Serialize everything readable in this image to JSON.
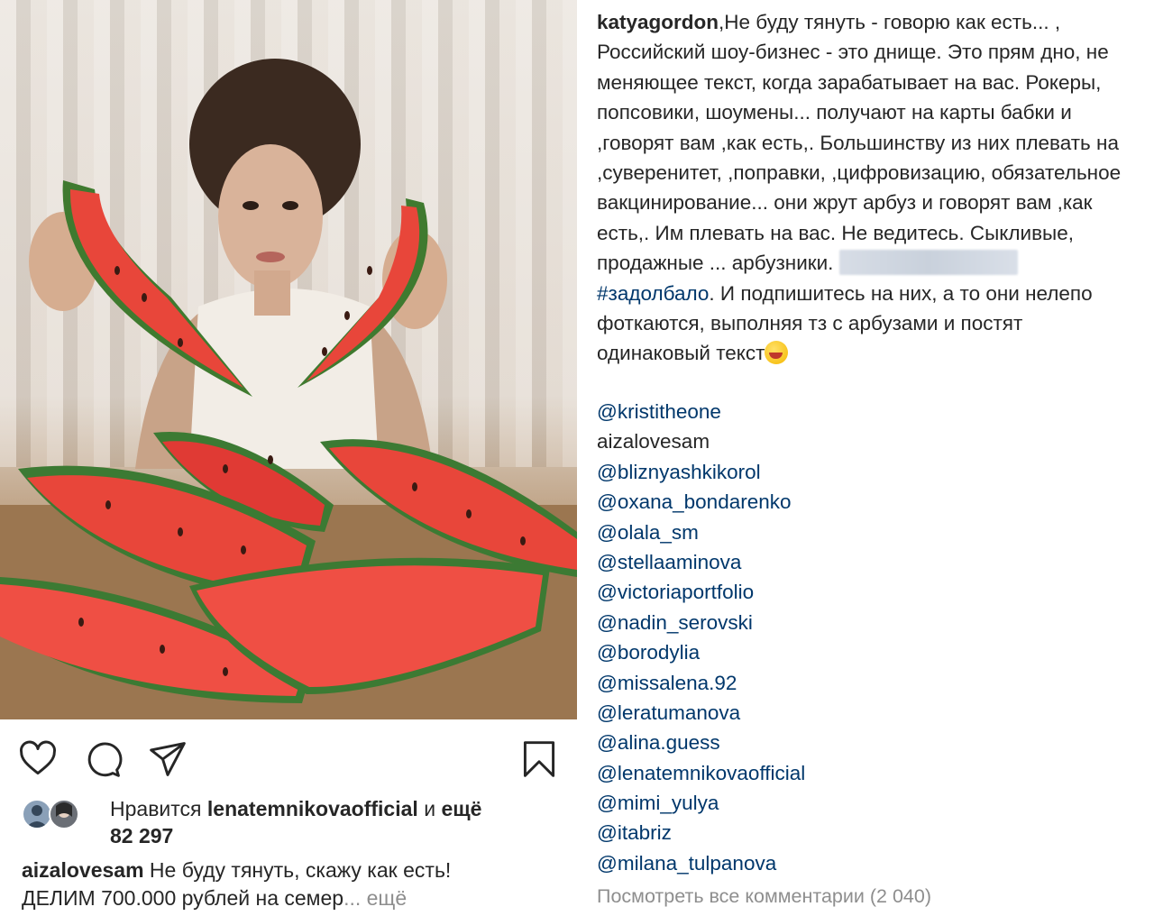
{
  "post": {
    "liked_by_prefix": "Нравится",
    "liked_by_user": "lenatemnikovaofficial",
    "liked_by_and": "и",
    "liked_by_more": "ещё",
    "likes_count": "82 297",
    "caption_user": "aizalovesam",
    "caption_line1": "Не буду тянуть, скажу как есть!",
    "caption_line2": "ДЕЛИМ 700.000 рублей на семер",
    "caption_ellipsis": "...",
    "caption_more": "ещё"
  },
  "icons": {
    "like": "heart-icon",
    "comment": "comment-icon",
    "share": "paper-plane-icon",
    "save": "bookmark-icon"
  },
  "comment": {
    "user": "katyagordon",
    "text_part1": ",Не буду тянуть - говорю как есть... , Российский шоу-бизнес - это днище. Это прям дно, не меняющее текст, когда зарабатывает на вас. Рокеры, попсовики, шоумены... получают на карты бабки и ,говорят вам ,как есть,. Большинству из них плевать на ,суверенитет, ,поправки, ,цифровизацию, обязательное вакцинирование... они жрут арбуз и говорят вам ,как есть,. Им плевать на вас. Не ведитесь. Сыкливые, продажные ... арбузники.",
    "hashtag": "#задолбало",
    "text_part2": ". И подпишитесь на них, а то они нелепо фоткаются, выполняя тз с арбузами и постят одинаковый текст"
  },
  "mentions": [
    "@kristitheone",
    "aizalovesam",
    "@bliznyashkikorol",
    "@oxana_bondarenko",
    "@olala_sm",
    "@stellaaminova",
    "@victoriaportfolio",
    "@nadin_serovski",
    "@borodylia",
    "@missalena.92",
    "@leratumanova",
    "@alina.guess",
    "@lenatemnikovaofficial",
    "@mimi_yulya",
    "@itabriz",
    "@milana_tulpanova"
  ],
  "view_all_comments": "Посмотреть все комментарии (2 040)"
}
